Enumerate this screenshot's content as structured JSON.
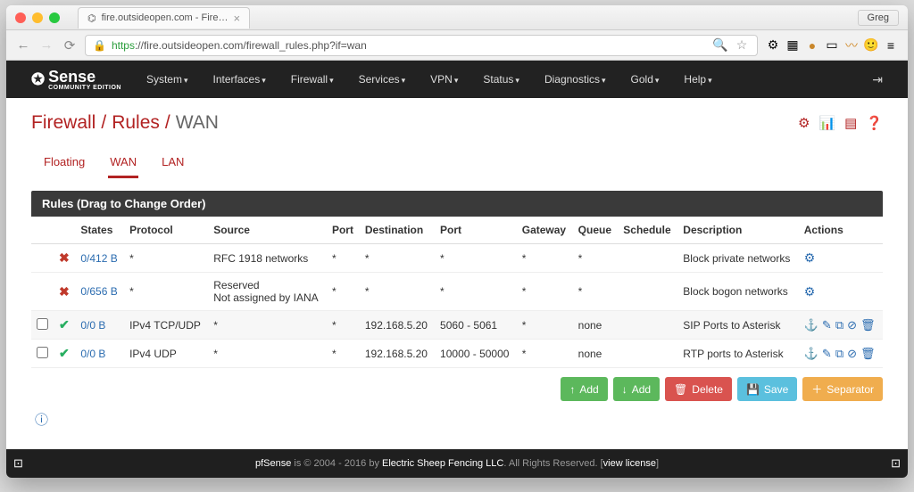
{
  "browser": {
    "tab_title": "fire.outsideopen.com - Fire…",
    "profile": "Greg",
    "url_scheme": "https",
    "url_host_path": "://fire.outsideopen.com/firewall_rules.php?if=wan"
  },
  "topnav": {
    "logo_main": "Sense",
    "logo_sub": "COMMUNITY EDITION",
    "items": [
      "System",
      "Interfaces",
      "Firewall",
      "Services",
      "VPN",
      "Status",
      "Diagnostics",
      "Gold",
      "Help"
    ]
  },
  "breadcrumb": {
    "a": "Firewall",
    "b": "Rules",
    "c": "WAN"
  },
  "tabs": {
    "floating": "Floating",
    "wan": "WAN",
    "lan": "LAN"
  },
  "panel_title": "Rules (Drag to Change Order)",
  "columns": {
    "states": "States",
    "protocol": "Protocol",
    "source": "Source",
    "port": "Port",
    "destination": "Destination",
    "dport": "Port",
    "gateway": "Gateway",
    "queue": "Queue",
    "schedule": "Schedule",
    "description": "Description",
    "actions": "Actions"
  },
  "rows": [
    {
      "checkbox": false,
      "type": "block",
      "states": "0/412 B",
      "protocol": "*",
      "source": "RFC 1918 networks",
      "sport": "*",
      "destination": "*",
      "dport": "*",
      "gateway": "*",
      "queue": "*",
      "schedule": "",
      "description": "Block private networks",
      "actions": "gear"
    },
    {
      "checkbox": false,
      "type": "block",
      "states": "0/656 B",
      "protocol": "*",
      "source": "Reserved\nNot assigned by IANA",
      "sport": "*",
      "destination": "*",
      "dport": "*",
      "gateway": "*",
      "queue": "*",
      "schedule": "",
      "description": "Block bogon networks",
      "actions": "gear"
    },
    {
      "checkbox": true,
      "type": "pass",
      "states": "0/0 B",
      "protocol": "IPv4 TCP/UDP",
      "source": "*",
      "sport": "*",
      "destination": "192.168.5.20",
      "dport": "5060 - 5061",
      "gateway": "*",
      "queue": "none",
      "schedule": "",
      "description": "SIP Ports to Asterisk",
      "actions": "full"
    },
    {
      "checkbox": true,
      "type": "pass",
      "states": "0/0 B",
      "protocol": "IPv4 UDP",
      "source": "*",
      "sport": "*",
      "destination": "192.168.5.20",
      "dport": "10000 - 50000",
      "gateway": "*",
      "queue": "none",
      "schedule": "",
      "description": "RTP ports to Asterisk",
      "actions": "full"
    }
  ],
  "buttons": {
    "add_up": "Add",
    "add_down": "Add",
    "delete": "Delete",
    "save": "Save",
    "separator": "Separator"
  },
  "footer": {
    "brand": "pfSense",
    "mid": " is © 2004 - 2016 by ",
    "company": "Electric Sheep Fencing LLC",
    "tail": ". All Rights Reserved. [",
    "link": "view license",
    "close": "]"
  }
}
